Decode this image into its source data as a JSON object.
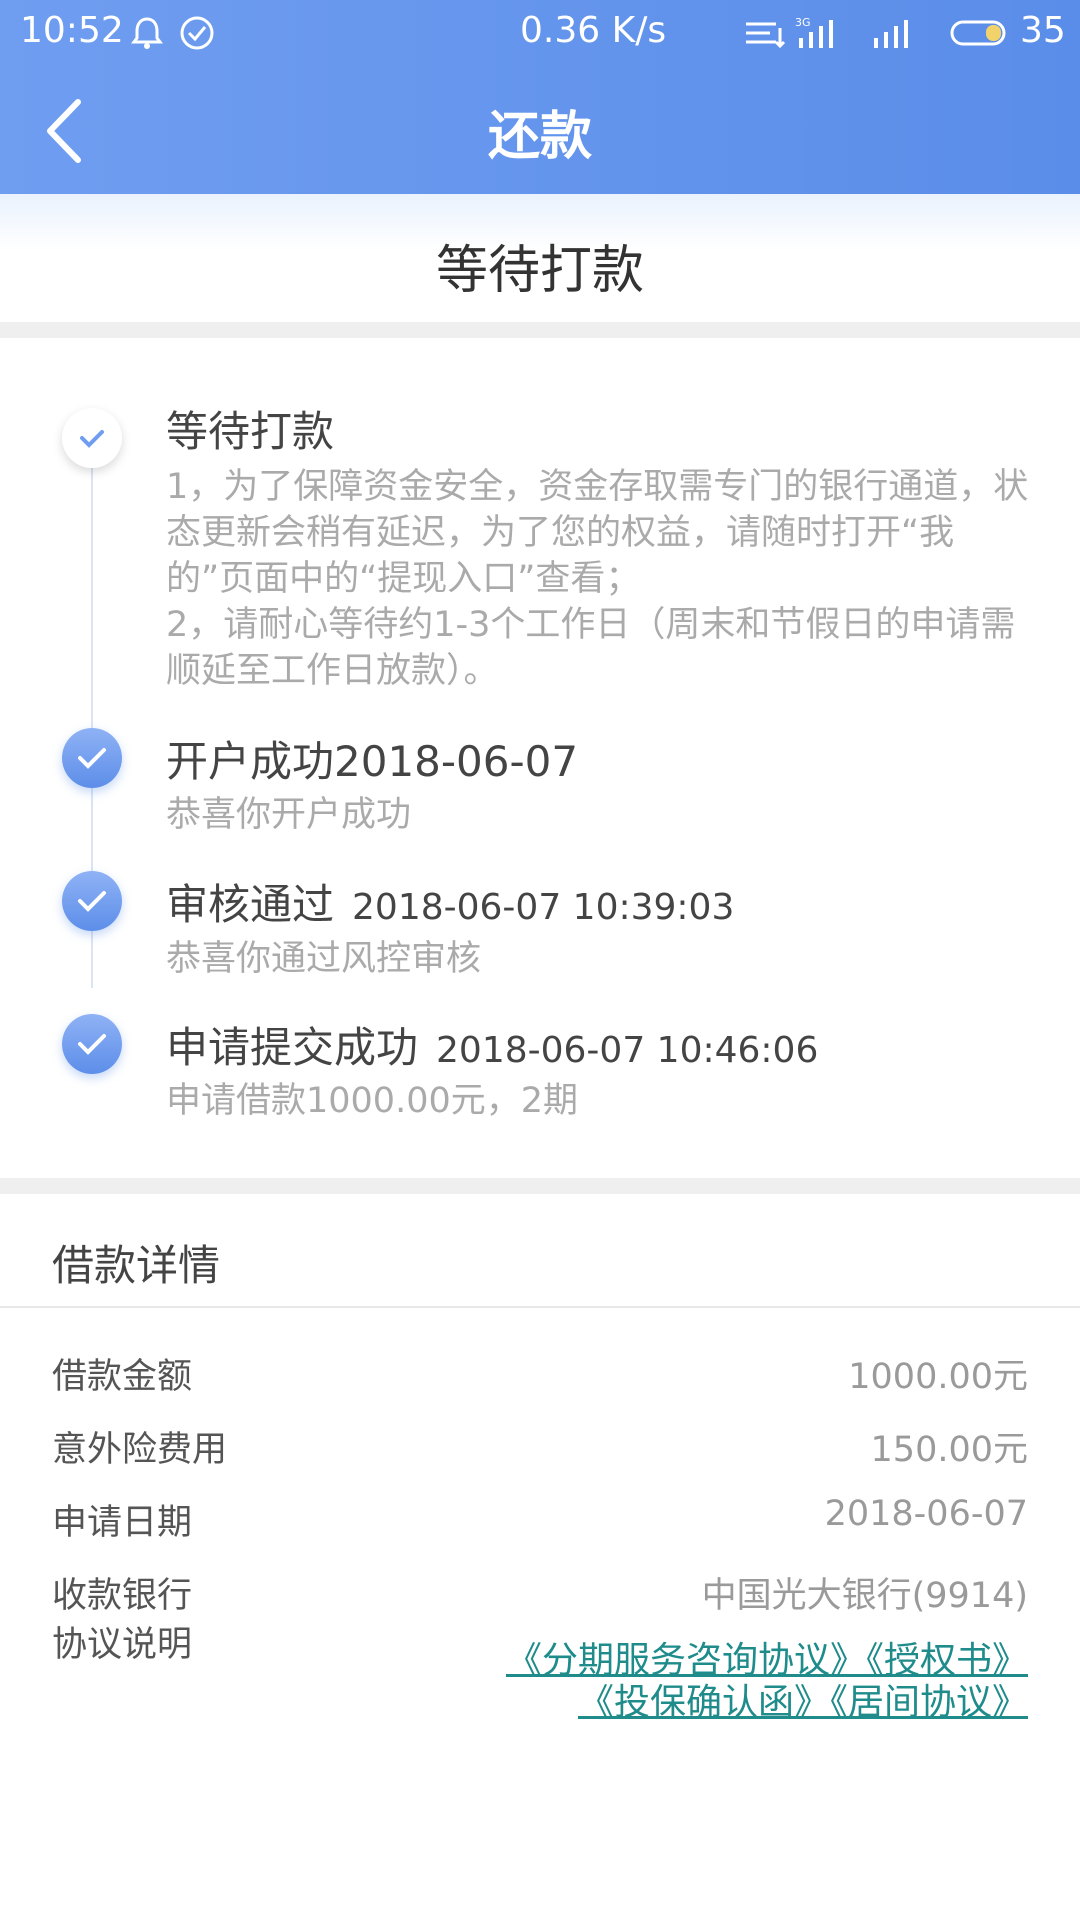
{
  "status_bar": {
    "time": "10:52",
    "network_speed": "0.36 K/s",
    "battery": "35",
    "network_type": "3G"
  },
  "navbar": {
    "title": "还款"
  },
  "banner": {
    "status_text": "等待打款"
  },
  "timeline": [
    {
      "title": "等待打款",
      "timestamp": "",
      "description": "1，为了保障资金安全，资金存取需专门的银行通道，状态更新会稍有延迟，为了您的权益，请随时打开“我的”页面中的“提现入口”查看；\n2，请耐心等待约1-3个工作日（周末和节假日的申请需顺延至工作日放款）。",
      "state": "pending"
    },
    {
      "title": "开户成功2018-06-07",
      "timestamp": "",
      "description": "恭喜你开户成功",
      "state": "done"
    },
    {
      "title": "审核通过",
      "timestamp": "2018-06-07 10:39:03",
      "description": "恭喜你通过风控审核",
      "state": "done"
    },
    {
      "title": "申请提交成功",
      "timestamp": "2018-06-07 10:46:06",
      "description": "申请借款1000.00元，2期",
      "state": "done"
    }
  ],
  "details": {
    "title": "借款详情",
    "rows": [
      {
        "label": "借款金额",
        "value": "1000.00元"
      },
      {
        "label": "意外险费用",
        "value": "150.00元"
      },
      {
        "label": "申请日期",
        "value": "2018-06-07"
      },
      {
        "label": "收款银行",
        "value": "中国光大银行(9914)"
      }
    ],
    "agreement_label": "协议说明",
    "agreements": [
      "《分期服务咨询协议》",
      "《授权书》",
      "《投保确认函》",
      "《居间协议》"
    ]
  },
  "colors": {
    "header_blue": "#5a8de9",
    "link_teal": "#1f8b8b"
  }
}
